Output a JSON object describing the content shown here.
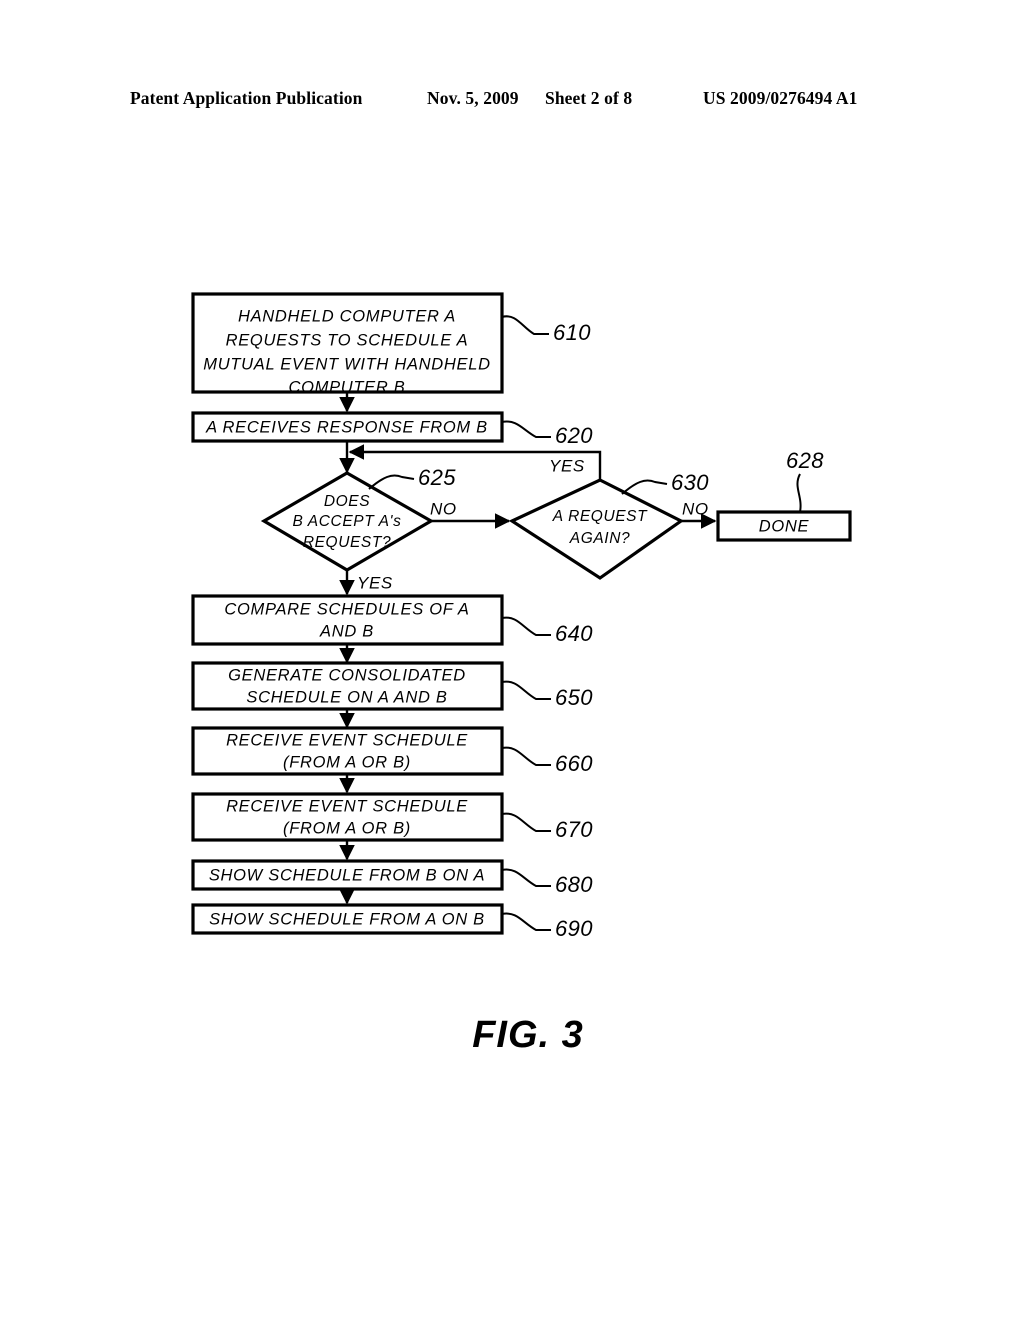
{
  "header": {
    "publication": "Patent Application Publication",
    "date": "Nov. 5, 2009",
    "sheet": "Sheet 2 of 8",
    "document_number": "US 2009/0276494 A1"
  },
  "figure": {
    "caption": "FIG.  3"
  },
  "flowchart": {
    "nodes": [
      {
        "id": "610",
        "shape": "process",
        "ref": "610",
        "lines": [
          "HANDHELD  COMPUTER  A",
          "REQUESTS  TO  SCHEDULE  A",
          "MUTUAL  EVENT  WITH  HANDHELD",
          "COMPUTER  B"
        ]
      },
      {
        "id": "620",
        "shape": "process",
        "ref": "620",
        "lines": [
          "A  RECEIVES  RESPONSE  FROM  B"
        ]
      },
      {
        "id": "625",
        "shape": "decision",
        "ref": "625",
        "lines": [
          "DOES",
          "B  ACCEPT  A's",
          "REQUEST?"
        ]
      },
      {
        "id": "630",
        "shape": "decision",
        "ref": "630",
        "lines": [
          "A  REQUEST",
          "AGAIN?"
        ]
      },
      {
        "id": "628",
        "shape": "terminator",
        "ref": "628",
        "lines": [
          "DONE"
        ]
      },
      {
        "id": "640",
        "shape": "process",
        "ref": "640",
        "lines": [
          "COMPARE  SCHEDULES  OF  A",
          "AND  B"
        ]
      },
      {
        "id": "650",
        "shape": "process",
        "ref": "650",
        "lines": [
          "GENERATE  CONSOLIDATED",
          "SCHEDULE  ON  A  AND  B"
        ]
      },
      {
        "id": "660",
        "shape": "process",
        "ref": "660",
        "lines": [
          "RECEIVE  EVENT  SCHEDULE",
          "(FROM  A  OR  B)"
        ]
      },
      {
        "id": "670",
        "shape": "process",
        "ref": "670",
        "lines": [
          "RECEIVE  EVENT  SCHEDULE",
          "(FROM  A  OR  B)"
        ]
      },
      {
        "id": "680",
        "shape": "process",
        "ref": "680",
        "lines": [
          "SHOW  SCHEDULE  FROM  B  ON  A"
        ]
      },
      {
        "id": "690",
        "shape": "process",
        "ref": "690",
        "lines": [
          "SHOW  SCHEDULE  FROM  A  ON  B"
        ]
      }
    ],
    "branch_labels": {
      "b625_no": "NO",
      "b625_yes": "YES",
      "b630_no": "NO",
      "b630_yes": "YES"
    }
  }
}
